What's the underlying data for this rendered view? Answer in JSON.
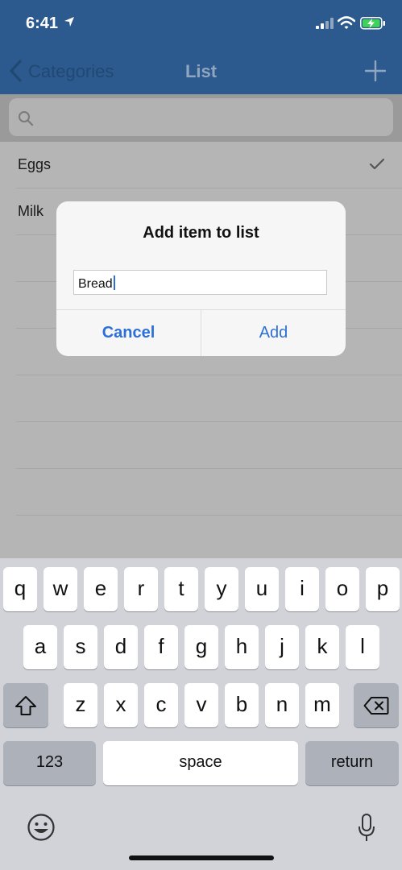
{
  "status_bar": {
    "time": "6:41"
  },
  "nav": {
    "back_label": "Categories",
    "title": "List"
  },
  "list": {
    "items": [
      "Eggs",
      "Milk"
    ]
  },
  "dialog": {
    "title": "Add item to list",
    "input_value": "Bread",
    "cancel_label": "Cancel",
    "add_label": "Add"
  },
  "keyboard": {
    "row1": [
      "q",
      "w",
      "e",
      "r",
      "t",
      "y",
      "u",
      "i",
      "o",
      "p"
    ],
    "row2": [
      "a",
      "s",
      "d",
      "f",
      "g",
      "h",
      "j",
      "k",
      "l"
    ],
    "row3": [
      "z",
      "x",
      "c",
      "v",
      "b",
      "n",
      "m"
    ],
    "numbers_label": "123",
    "space_label": "space",
    "return_label": "return"
  },
  "colors": {
    "accent": "#2c6fd8",
    "nav_bar": "#2d5a8e"
  }
}
